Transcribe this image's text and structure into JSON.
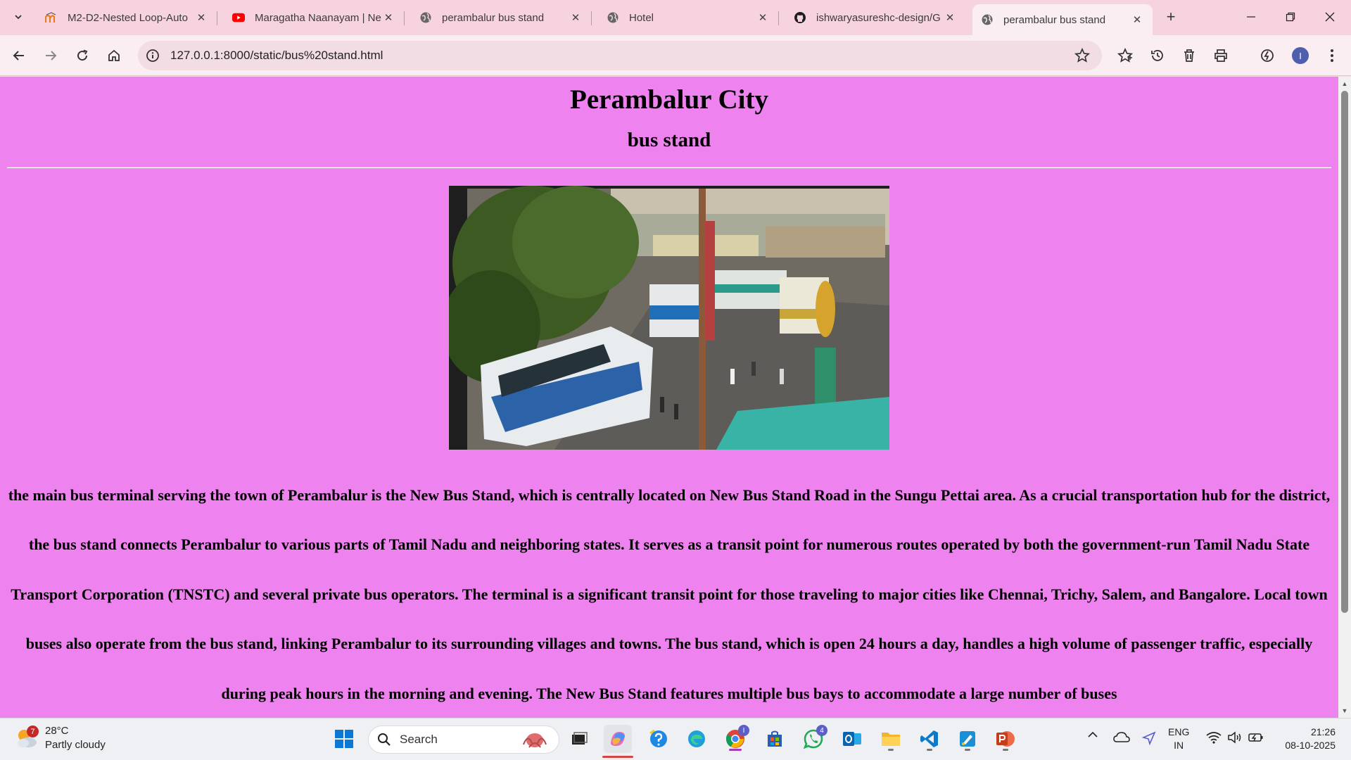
{
  "browser": {
    "tabs": [
      {
        "title": "M2-D2-Nested Loop-Auto",
        "icon": "moodle-icon"
      },
      {
        "title": "Maragatha Naanayam | Ne",
        "icon": "youtube-icon"
      },
      {
        "title": "perambalur bus stand",
        "icon": "globe-icon"
      },
      {
        "title": "Hotel",
        "icon": "globe-icon"
      },
      {
        "title": "ishwaryasureshc-design/G",
        "icon": "github-icon"
      },
      {
        "title": "perambalur bus stand",
        "icon": "globe-icon",
        "active": true
      }
    ],
    "url": "127.0.0.1:8000/static/bus%20stand.html",
    "profile_initial": "I",
    "theme": {
      "tabstrip": "#f7d3df",
      "toolbar": "#fbeef3"
    }
  },
  "page": {
    "background": "#ee82ee",
    "heading": "Perambalur City",
    "subheading": "bus stand",
    "photo_alt": "Perambalur bus stand photo",
    "description": "the main bus terminal serving the town of Perambalur is the New Bus Stand, which is centrally located on New Bus Stand Road in the Sungu Pettai area. As a crucial transportation hub for the district, the bus stand connects Perambalur to various parts of Tamil Nadu and neighboring states. It serves as a transit point for numerous routes operated by both the government-run Tamil Nadu State Transport Corporation (TNSTC) and several private bus operators. The terminal is a significant transit point for those traveling to major cities like Chennai, Trichy, Salem, and Bangalore. Local town buses also operate from the bus stand, linking Perambalur to its surrounding villages and towns. The bus stand, which is open 24 hours a day, handles a high volume of passenger traffic, especially during peak hours in the morning and evening. The New Bus Stand features multiple bus bays to accommodate a large number of buses"
  },
  "taskbar": {
    "weather": {
      "temp": "28°C",
      "condition": "Partly cloudy",
      "badge": "7"
    },
    "search_label": "Search",
    "chrome_badge": "I",
    "whatsapp_badge": "4",
    "lang": {
      "line1": "ENG",
      "line2": "IN"
    },
    "clock": {
      "time": "21:26",
      "date": "08-10-2025"
    }
  }
}
